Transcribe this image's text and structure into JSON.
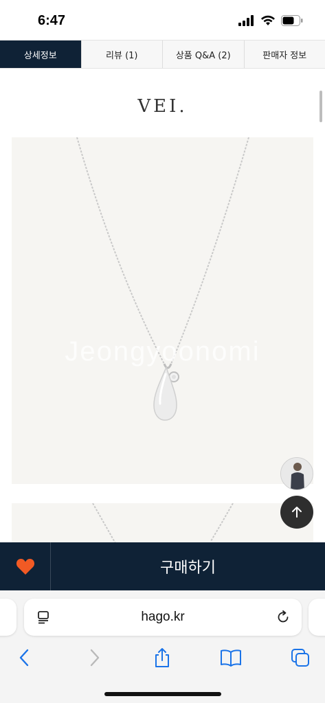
{
  "status": {
    "time": "6:47"
  },
  "tabs": [
    {
      "label": "상세정보"
    },
    {
      "label": "리뷰 (1)"
    },
    {
      "label": "상품 Q&A (2)"
    },
    {
      "label": "판매자 정보"
    }
  ],
  "content": {
    "brand": "VEI.",
    "watermark": "Jeongyoonomi"
  },
  "buy_bar": {
    "buy_label": "구매하기"
  },
  "browser": {
    "url": "hago.kr"
  },
  "colors": {
    "navy": "#0f2236",
    "heart": "#f15a24",
    "ios_blue": "#1a73e8"
  },
  "icons": {
    "wish": "heart-icon",
    "top": "arrow-up-icon",
    "reader": "reader-icon",
    "reload": "reload-icon",
    "back": "back-icon",
    "forward": "forward-icon",
    "share": "share-icon",
    "bookmarks": "bookmarks-icon",
    "tabs": "tabs-icon"
  }
}
